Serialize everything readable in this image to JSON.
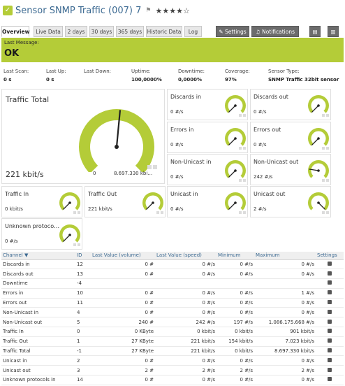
{
  "header": {
    "title": "Sensor SNMP Traffic (007) 7",
    "flag": "⚑",
    "stars": "★★★★☆"
  },
  "tabs": [
    "Overview",
    "Live Data",
    "2 days",
    "30 days",
    "365 days",
    "Historic Data",
    "Log"
  ],
  "toolbar": {
    "settings": "Settings",
    "notifications": "Notifications"
  },
  "status": {
    "label": "Last Message:",
    "value": "OK"
  },
  "info": [
    {
      "label": "Last Scan:",
      "value": "0 s"
    },
    {
      "label": "Last Up:",
      "value": "0 s"
    },
    {
      "label": "Last Down:",
      "value": ""
    },
    {
      "label": "Uptime:",
      "value": "100,0000%"
    },
    {
      "label": "Downtime:",
      "value": "0,0000%"
    },
    {
      "label": "Coverage:",
      "value": "97%"
    },
    {
      "label": "Sensor Type:",
      "value": "SNMP Traffic 32bit sensor"
    }
  ],
  "gauges": {
    "total": {
      "name": "Traffic Total",
      "value": "221 kbit/s",
      "min": "0",
      "max": "8.697.330 kbi…",
      "level": 0.52
    },
    "discards_in": {
      "name": "Discards in",
      "value": "0 #/s",
      "level": 0.0
    },
    "discards_out": {
      "name": "Discards out",
      "value": "0 #/s",
      "level": 0.0
    },
    "errors_in": {
      "name": "Errors in",
      "value": "0 #/s",
      "level": 0.0
    },
    "errors_out": {
      "name": "Errors out",
      "value": "0 #/s",
      "level": 0.0
    },
    "nonuni_in": {
      "name": "Non-Unicast in",
      "value": "0 #/s",
      "level": 0.0
    },
    "nonuni_out": {
      "name": "Non-Unicast out",
      "value": "242 #/s",
      "level": 0.2
    },
    "traffic_in": {
      "name": "Traffic In",
      "value": "0 kbit/s",
      "level": 0.0
    },
    "traffic_out": {
      "name": "Traffic Out",
      "value": "221 kbit/s",
      "level": 0.0
    },
    "unicast_in": {
      "name": "Unicast in",
      "value": "0 #/s",
      "level": 0.0
    },
    "unicast_out": {
      "name": "Unicast out",
      "value": "2 #/s",
      "level": 1.0
    },
    "unknown": {
      "name": "Unknown protoco…",
      "value": "0 #/s",
      "level": 0.0
    }
  },
  "colors": {
    "accent": "#b4cc38",
    "link": "#3c6a92"
  },
  "table": {
    "headers": [
      "Channel ▼",
      "ID",
      "Last Value (volume)",
      "Last Value (speed)",
      "Minimum",
      "Maximum",
      "Settings"
    ],
    "rows": [
      [
        "Discards in",
        "12",
        "0 #",
        "0 #/s",
        "0 #/s",
        "0 #/s"
      ],
      [
        "Discards out",
        "13",
        "0 #",
        "0 #/s",
        "0 #/s",
        "0 #/s"
      ],
      [
        "Downtime",
        "-4",
        "",
        "",
        "",
        ""
      ],
      [
        "Errors in",
        "10",
        "0 #",
        "0 #/s",
        "0 #/s",
        "1 #/s"
      ],
      [
        "Errors out",
        "11",
        "0 #",
        "0 #/s",
        "0 #/s",
        "0 #/s"
      ],
      [
        "Non-Unicast in",
        "4",
        "0 #",
        "0 #/s",
        "0 #/s",
        "0 #/s"
      ],
      [
        "Non-Unicast out",
        "5",
        "240 #",
        "242 #/s",
        "197 #/s",
        "1.086.175.668 #/s"
      ],
      [
        "Traffic In",
        "0",
        "0 KByte",
        "0 kbit/s",
        "0 kbit/s",
        "901 kbit/s"
      ],
      [
        "Traffic Out",
        "1",
        "27 KByte",
        "221 kbit/s",
        "154 kbit/s",
        "7.023 kbit/s"
      ],
      [
        "Traffic Total",
        "-1",
        "27 KByte",
        "221 kbit/s",
        "0 kbit/s",
        "8.697.330 kbit/s"
      ],
      [
        "Unicast in",
        "2",
        "0 #",
        "0 #/s",
        "0 #/s",
        "0 #/s"
      ],
      [
        "Unicast out",
        "3",
        "2 #",
        "2 #/s",
        "2 #/s",
        "2 #/s"
      ],
      [
        "Unknown protocols in",
        "14",
        "0 #",
        "0 #/s",
        "0 #/s",
        "0 #/s"
      ]
    ]
  }
}
